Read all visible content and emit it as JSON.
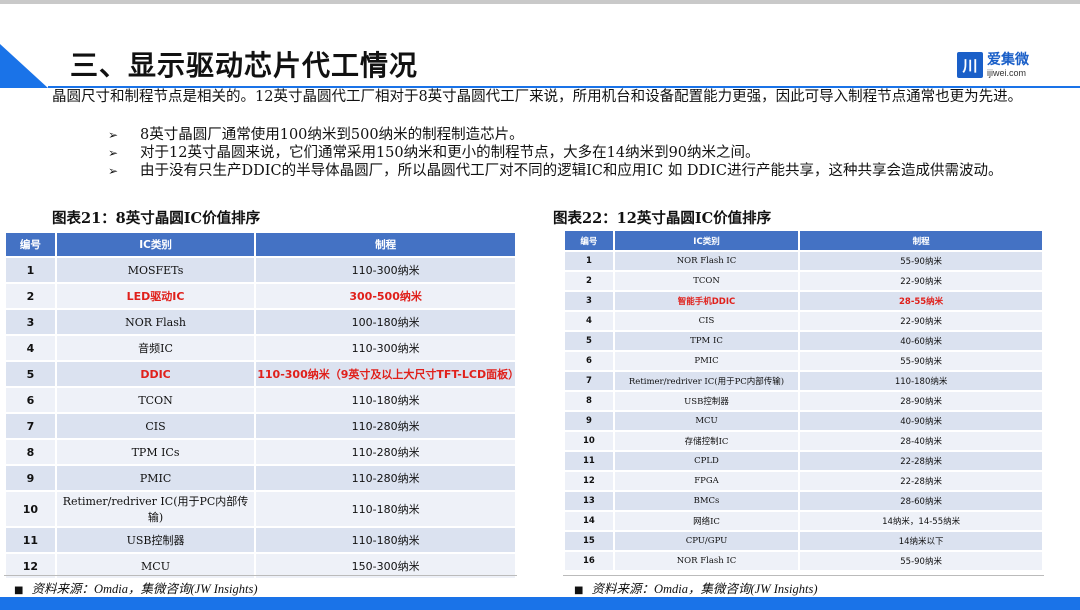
{
  "header": {
    "title": "三、显示驱动芯片代工情况",
    "logo_mark": "川",
    "logo_cn": "爱集微",
    "logo_en": "ijiwei.com"
  },
  "intro": "晶圆尺寸和制程节点是相关的。12英寸晶圆代工厂相对于8英寸晶圆代工厂来说，所用机台和设备配置能力更强，因此可导入制程节点通常也更为先进。",
  "bullets": [
    "8英寸晶圆厂通常使用100纳米到500纳米的制程制造芯片。",
    "对于12英寸晶圆来说，它们通常采用150纳米和更小的制程节点，大多在14纳米到90纳米之间。",
    "由于没有只生产DDIC的半导体晶圆厂，所以晶圆代工厂对不同的逻辑IC和应用IC 如 DDIC进行产能共享，这种共享会造成供需波动。"
  ],
  "bullet_glyph": "➢",
  "table1": {
    "title": "图表21：8英寸晶圆IC价值排序",
    "headers": [
      "编号",
      "IC类别",
      "制程"
    ],
    "rows": [
      [
        "1",
        "MOSFETs",
        "110-300纳米"
      ],
      [
        "2",
        "LED驱动IC",
        "300-500纳米"
      ],
      [
        "3",
        "NOR Flash",
        "100-180纳米"
      ],
      [
        "4",
        "音频IC",
        "110-300纳米"
      ],
      [
        "5",
        "DDIC",
        "110-300纳米（9英寸及以上大尺寸TFT-LCD面板）"
      ],
      [
        "6",
        "TCON",
        "110-180纳米"
      ],
      [
        "7",
        "CIS",
        "110-280纳米"
      ],
      [
        "8",
        "TPM ICs",
        "110-280纳米"
      ],
      [
        "9",
        "PMIC",
        "110-280纳米"
      ],
      [
        "10",
        "Retimer/redriver IC(用于PC内部传输)",
        "110-180纳米"
      ],
      [
        "11",
        "USB控制器",
        "110-180纳米"
      ],
      [
        "12",
        "MCU",
        "150-300纳米"
      ]
    ]
  },
  "table2": {
    "title": "图表22：12英寸晶圆IC价值排序",
    "headers": [
      "编号",
      "IC类别",
      "制程"
    ],
    "rows": [
      [
        "1",
        "NOR Flash IC",
        "55-90纳米"
      ],
      [
        "2",
        "TCON",
        "22-90纳米"
      ],
      [
        "3",
        "智能手机DDIC",
        "28-55纳米"
      ],
      [
        "4",
        "CIS",
        "22-90纳米"
      ],
      [
        "5",
        "TPM IC",
        "40-60纳米"
      ],
      [
        "6",
        "PMIC",
        "55-90纳米"
      ],
      [
        "7",
        "Retimer/redriver IC(用于PC内部传输)",
        "110-180纳米"
      ],
      [
        "8",
        "USB控制器",
        "28-90纳米"
      ],
      [
        "9",
        "MCU",
        "40-90纳米"
      ],
      [
        "10",
        "存储控制IC",
        "28-40纳米"
      ],
      [
        "11",
        "CPLD",
        "22-28纳米"
      ],
      [
        "12",
        "FPGA",
        "22-28纳米"
      ],
      [
        "13",
        "BMCs",
        "28-60纳米"
      ],
      [
        "14",
        "网络IC",
        "14纳米，14-55纳米"
      ],
      [
        "15",
        "CPU/GPU",
        "14纳米以下"
      ],
      [
        "16",
        "NOR Flash IC",
        "55-90纳米"
      ]
    ]
  },
  "highlight_color": "#e0201b",
  "source": {
    "square": "■",
    "text": "资料来源：Omdia，集微咨询(JW Insights)"
  }
}
